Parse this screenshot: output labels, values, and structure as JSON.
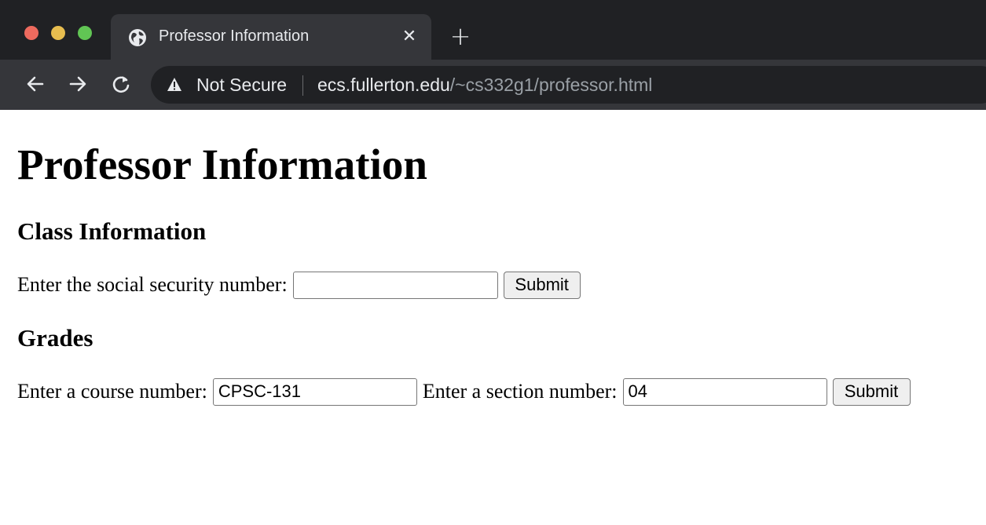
{
  "browser": {
    "tab_title": "Professor Information",
    "tab_close_glyph": "✕",
    "new_tab_glyph": "+",
    "security_label": "Not Secure",
    "url_host": "ecs.fullerton.edu",
    "url_path": "/~cs332g1/professor.html"
  },
  "page": {
    "title": "Professor Information",
    "class_section": {
      "heading": "Class Information",
      "ssn_label": "Enter the social security number:",
      "ssn_value": "",
      "submit_label": "Submit"
    },
    "grades_section": {
      "heading": "Grades",
      "course_label": "Enter a course number:",
      "course_value": "CPSC-131",
      "section_label": "Enter a section number:",
      "section_value": "04",
      "submit_label": "Submit"
    }
  },
  "colors": {
    "tabstrip": "#202124",
    "toolbar": "#35363a",
    "close_red": "#ed6a5e",
    "minimize_yellow": "#e7bd4f",
    "maximize_green": "#61c554"
  }
}
